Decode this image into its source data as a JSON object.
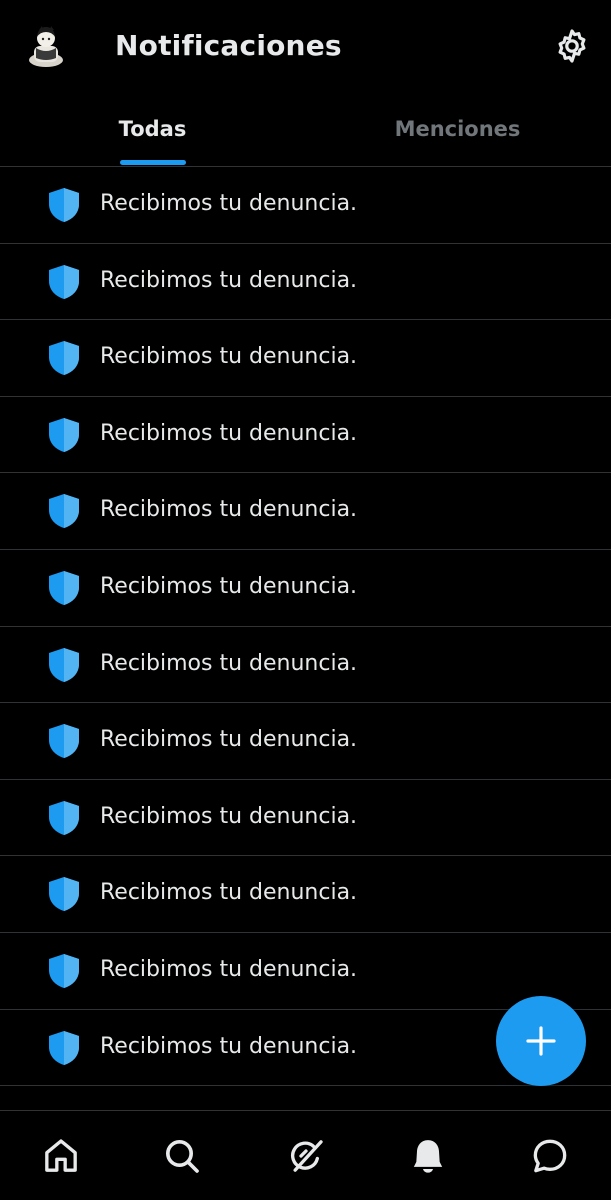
{
  "header": {
    "title": "Notificaciones",
    "avatar_icon": "user-avatar",
    "settings_icon": "gear-icon"
  },
  "tabs": [
    {
      "label": "Todas",
      "active": true
    },
    {
      "label": "Menciones",
      "active": false
    }
  ],
  "notifications": [
    {
      "icon": "shield-icon",
      "text": "Recibimos tu denuncia."
    },
    {
      "icon": "shield-icon",
      "text": "Recibimos tu denuncia."
    },
    {
      "icon": "shield-icon",
      "text": "Recibimos tu denuncia."
    },
    {
      "icon": "shield-icon",
      "text": "Recibimos tu denuncia."
    },
    {
      "icon": "shield-icon",
      "text": "Recibimos tu denuncia."
    },
    {
      "icon": "shield-icon",
      "text": "Recibimos tu denuncia."
    },
    {
      "icon": "shield-icon",
      "text": "Recibimos tu denuncia."
    },
    {
      "icon": "shield-icon",
      "text": "Recibimos tu denuncia."
    },
    {
      "icon": "shield-icon",
      "text": "Recibimos tu denuncia."
    },
    {
      "icon": "shield-icon",
      "text": "Recibimos tu denuncia."
    },
    {
      "icon": "shield-icon",
      "text": "Recibimos tu denuncia."
    },
    {
      "icon": "shield-icon",
      "text": "Recibimos tu denuncia."
    }
  ],
  "fab": {
    "icon": "plus-icon"
  },
  "bottom_nav": [
    {
      "icon": "home-icon"
    },
    {
      "icon": "search-icon"
    },
    {
      "icon": "grok-icon"
    },
    {
      "icon": "bell-icon",
      "active": true
    },
    {
      "icon": "message-icon"
    }
  ],
  "colors": {
    "accent": "#1d9bf0",
    "background": "#000000",
    "divider": "#2f3336",
    "text_primary": "#e7e9ea",
    "text_secondary": "#71767b"
  }
}
